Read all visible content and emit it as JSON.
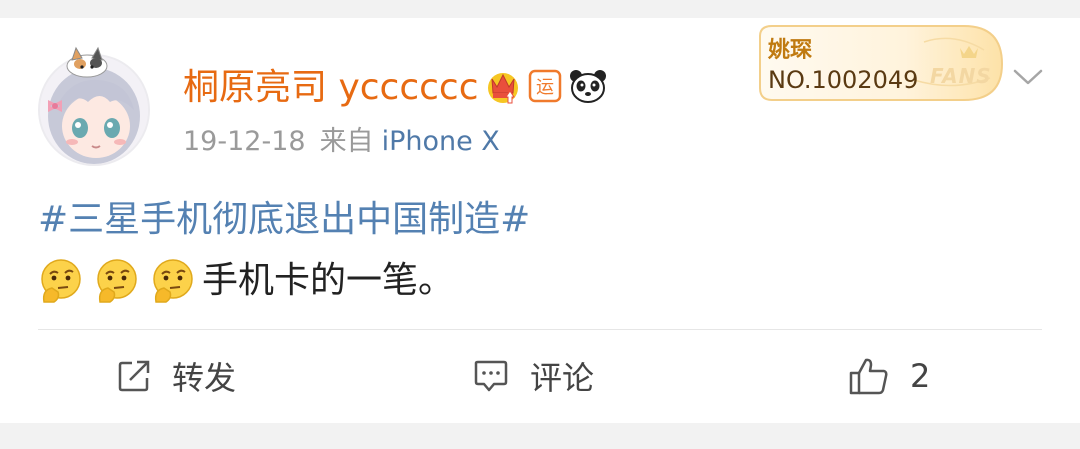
{
  "post": {
    "author": {
      "name": "桐原亮司 ycccccc",
      "badges": [
        "crown-vip-icon",
        "yun-luck-icon",
        "panda-icon"
      ],
      "badge_text": "运"
    },
    "timestamp": "19-12-18",
    "source_prefix": "来自",
    "source_device": "iPhone X",
    "topic": "#三星手机彻底退出中国制造#",
    "text": "手机卡的一笔。",
    "emojis": [
      "thinking-face-icon",
      "thinking-face-icon",
      "thinking-face-icon"
    ]
  },
  "fans_badge": {
    "name": "姚琛",
    "number": "NO.1002049",
    "word": "FANS"
  },
  "actions": {
    "repost_label": "转发",
    "comment_label": "评论",
    "like_count": "2"
  },
  "colors": {
    "username": "#e76a12",
    "link": "#5481b2",
    "meta": "#9a9a9a",
    "text": "#222222"
  }
}
